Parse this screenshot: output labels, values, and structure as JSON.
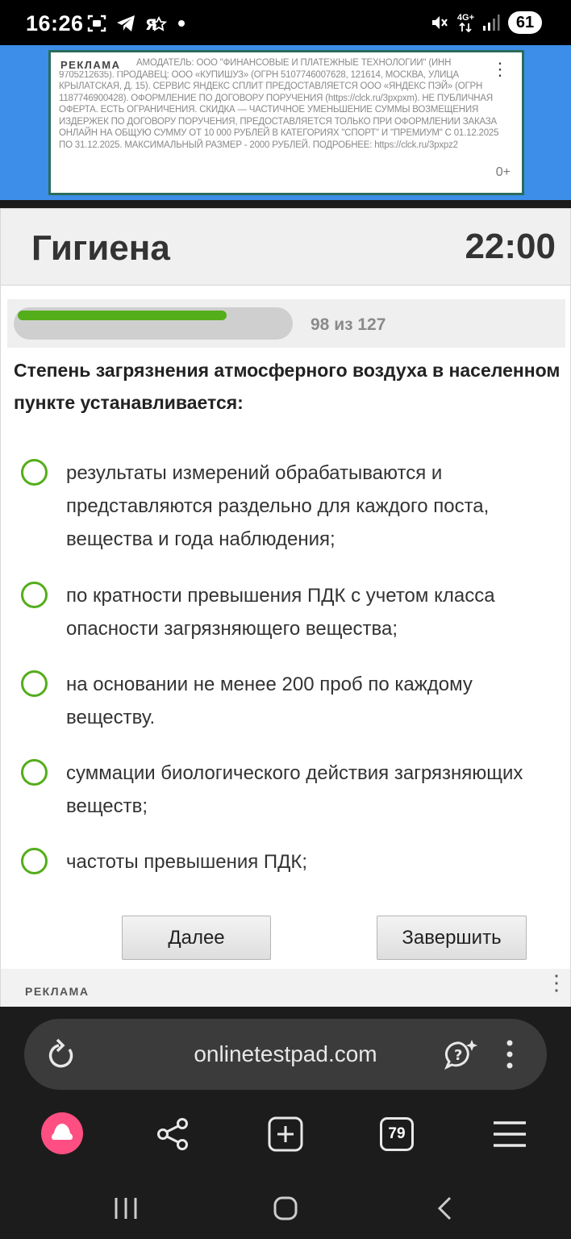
{
  "status_bar": {
    "time": "16:26",
    "left_icons": [
      "screen-record-icon",
      "telegram-icon",
      "yandex-icon",
      "dot-icon"
    ],
    "net_label_top": "4G+",
    "battery": "61"
  },
  "ad_top": {
    "label": "РЕКЛАМА",
    "text": "АМОДАТЕЛЬ: ООО \"ФИНАНСОВЫЕ И ПЛАТЕЖНЫЕ ТЕХНОЛОГИИ\" (ИНН 9705212635). ПРОДАВЕЦ: ООО «КУПИШУЗ» (ОГРН 5107746007628, 121614, МОСКВА, УЛИЦА КРЫЛАТСКАЯ, Д. 15). СЕРВИС ЯНДЕКС СПЛИТ ПРЕДОСТАВЛЯЕТСЯ ООО «ЯНДЕКС ПЭЙ» (ОГРН 1187746900428). ОФОРМЛЕНИЕ ПО ДОГОВОРУ ПОРУЧЕНИЯ (https://clck.ru/3pxpxm). НЕ ПУБЛИЧНАЯ ОФЕРТА. ЕСТЬ ОГРАНИЧЕНИЯ. СКИДКА — ЧАСТИЧНОЕ УМЕНЬШЕНИЕ СУММЫ ВОЗМЕЩЕНИЯ ИЗДЕРЖЕК ПО ДОГОВОРУ ПОРУЧЕНИЯ, ПРЕДОСТАВЛЯЕТСЯ ТОЛЬКО ПРИ ОФОРМЛЕНИИ ЗАКАЗА ОНЛАЙН НА ОБЩУЮ СУММУ ОТ 10 000 РУБЛЕЙ В КАТЕГОРИЯХ \"СПОРТ\" И \"ПРЕМИУМ\" С 01.12.2025 ПО 31.12.2025. МАКСИМАЛЬНЫЙ РАЗМЕР - 2000 РУБЛЕЙ. ПОДРОБНЕЕ: https://clck.ru/3pxpz2",
    "age": "0+"
  },
  "test": {
    "title": "Гигиена",
    "timer": "22:00",
    "progress_text": "98 из 127",
    "progress_fraction": 0.772,
    "question": "Степень загрязнения атмосферного воздуха в населенном пункте устанавливается:",
    "answers": [
      "результаты измерений обрабатываются и представляются раздельно для каждого поста, вещества и года наблюдения;",
      "по кратности превышения ПДК с учетом класса опасности загрязняющего вещества;",
      "на основании не менее 200 проб по каждому веществу.",
      "суммации биологического действия загрязняющих веществ;",
      "частоты превышения ПДК;"
    ],
    "next_label": "Далее",
    "finish_label": "Завершить"
  },
  "ad_bottom": {
    "label": "РЕКЛАМА"
  },
  "browser": {
    "url": "onlinetestpad.com",
    "tab_count": "79"
  },
  "colors": {
    "accent": "#54ad1a",
    "ad_bg": "#3d8ee8",
    "alice": "#ff4f82"
  }
}
